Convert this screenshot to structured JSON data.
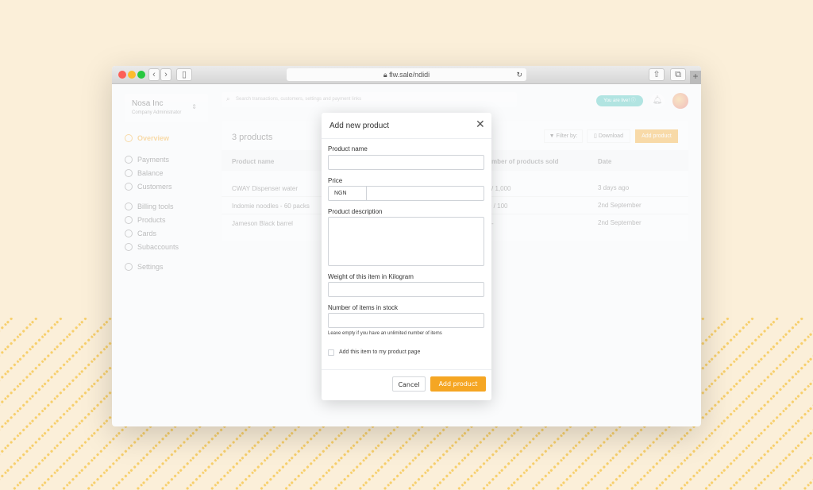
{
  "browser": {
    "url": "flw.sale/ndidi"
  },
  "account": {
    "name": "Nosa Inc",
    "role": "Company Administrator"
  },
  "search": {
    "placeholder": "Search transactions, customers, settings and payment links"
  },
  "header": {
    "live_badge": "You are live!"
  },
  "sidebar": {
    "items": [
      {
        "label": "Overview",
        "active": true
      },
      {
        "label": "Payments"
      },
      {
        "label": "Balance"
      },
      {
        "label": "Customers"
      },
      {
        "label": "Billing tools"
      },
      {
        "label": "Products"
      },
      {
        "label": "Cards"
      },
      {
        "label": "Subaccounts"
      },
      {
        "label": "Settings"
      }
    ]
  },
  "products": {
    "count_label": "3 products",
    "filter_label": "Filter by:",
    "download_label": "Download",
    "add_label": "Add product",
    "columns": [
      "Product name",
      "mber of products sold",
      "Date"
    ],
    "rows": [
      [
        "CWAY Dispenser water",
        "/ 1,000",
        "3 days ago"
      ],
      [
        "Indomie noodles - 60 packs",
        "0 / 100",
        "2nd September"
      ],
      [
        "Jameson  Black barrel",
        "-",
        "2nd September"
      ]
    ]
  },
  "modal": {
    "title": "Add new product",
    "product_name_label": "Product name",
    "price_label": "Price",
    "currency": "NGN",
    "description_label": "Product description",
    "weight_label": "Weight of this item in Kilogram",
    "stock_label": "Number of items in stock",
    "stock_hint": "Leave empty if you have an unlimited number of items",
    "checkbox_label": "Add this item to my product page",
    "checkbox_checked": false,
    "cancel_label": "Cancel",
    "submit_label": "Add product"
  },
  "colors": {
    "accent": "#f5a623",
    "background": "#fbefd9",
    "live": "#3cc1b7"
  }
}
